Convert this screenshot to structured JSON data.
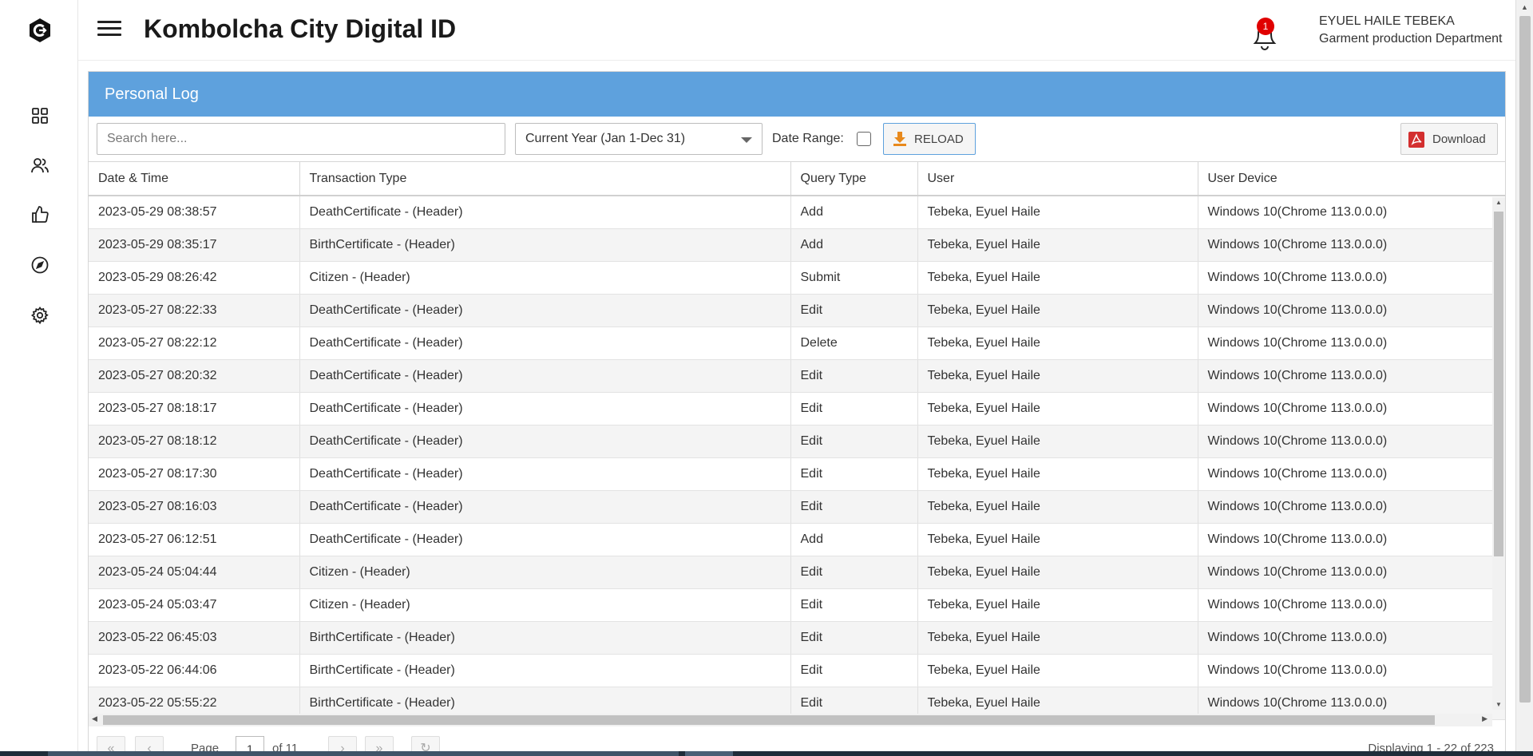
{
  "app": {
    "title": "Kombolcha City Digital ID"
  },
  "header": {
    "notification_count": "1",
    "user_name": "EYUEL HAILE TEBEKA",
    "user_department": "Garment production Department"
  },
  "sidebar": {
    "items": [
      {
        "icon": "dashboard-icon"
      },
      {
        "icon": "users-icon"
      },
      {
        "icon": "thumbs-up-icon"
      },
      {
        "icon": "compass-icon"
      },
      {
        "icon": "gear-icon"
      }
    ]
  },
  "panel": {
    "title": "Personal Log"
  },
  "toolbar": {
    "search_placeholder": "Search here...",
    "period_value": "Current Year (Jan 1-Dec 31)",
    "date_range_label": "Date Range:",
    "reload_label": "RELOAD",
    "download_label": "Download"
  },
  "table": {
    "columns": [
      "Date & Time",
      "Transaction Type",
      "Query Type",
      "User",
      "User Device"
    ],
    "rows": [
      [
        "2023-05-29 08:38:57",
        "DeathCertificate - (Header)",
        "Add",
        "Tebeka, Eyuel Haile",
        "Windows 10(Chrome 113.0.0.0)"
      ],
      [
        "2023-05-29 08:35:17",
        "BirthCertificate - (Header)",
        "Add",
        "Tebeka, Eyuel Haile",
        "Windows 10(Chrome 113.0.0.0)"
      ],
      [
        "2023-05-29 08:26:42",
        "Citizen - (Header)",
        "Submit",
        "Tebeka, Eyuel Haile",
        "Windows 10(Chrome 113.0.0.0)"
      ],
      [
        "2023-05-27 08:22:33",
        "DeathCertificate - (Header)",
        "Edit",
        "Tebeka, Eyuel Haile",
        "Windows 10(Chrome 113.0.0.0)"
      ],
      [
        "2023-05-27 08:22:12",
        "DeathCertificate - (Header)",
        "Delete",
        "Tebeka, Eyuel Haile",
        "Windows 10(Chrome 113.0.0.0)"
      ],
      [
        "2023-05-27 08:20:32",
        "DeathCertificate - (Header)",
        "Edit",
        "Tebeka, Eyuel Haile",
        "Windows 10(Chrome 113.0.0.0)"
      ],
      [
        "2023-05-27 08:18:17",
        "DeathCertificate - (Header)",
        "Edit",
        "Tebeka, Eyuel Haile",
        "Windows 10(Chrome 113.0.0.0)"
      ],
      [
        "2023-05-27 08:18:12",
        "DeathCertificate - (Header)",
        "Edit",
        "Tebeka, Eyuel Haile",
        "Windows 10(Chrome 113.0.0.0)"
      ],
      [
        "2023-05-27 08:17:30",
        "DeathCertificate - (Header)",
        "Edit",
        "Tebeka, Eyuel Haile",
        "Windows 10(Chrome 113.0.0.0)"
      ],
      [
        "2023-05-27 08:16:03",
        "DeathCertificate - (Header)",
        "Edit",
        "Tebeka, Eyuel Haile",
        "Windows 10(Chrome 113.0.0.0)"
      ],
      [
        "2023-05-27 06:12:51",
        "DeathCertificate - (Header)",
        "Add",
        "Tebeka, Eyuel Haile",
        "Windows 10(Chrome 113.0.0.0)"
      ],
      [
        "2023-05-24 05:04:44",
        "Citizen - (Header)",
        "Edit",
        "Tebeka, Eyuel Haile",
        "Windows 10(Chrome 113.0.0.0)"
      ],
      [
        "2023-05-24 05:03:47",
        "Citizen - (Header)",
        "Edit",
        "Tebeka, Eyuel Haile",
        "Windows 10(Chrome 113.0.0.0)"
      ],
      [
        "2023-05-22 06:45:03",
        "BirthCertificate - (Header)",
        "Edit",
        "Tebeka, Eyuel Haile",
        "Windows 10(Chrome 113.0.0.0)"
      ],
      [
        "2023-05-22 06:44:06",
        "BirthCertificate - (Header)",
        "Edit",
        "Tebeka, Eyuel Haile",
        "Windows 10(Chrome 113.0.0.0)"
      ],
      [
        "2023-05-22 05:55:22",
        "BirthCertificate - (Header)",
        "Edit",
        "Tebeka, Eyuel Haile",
        "Windows 10(Chrome 113.0.0.0)"
      ]
    ]
  },
  "pager": {
    "page_label": "Page",
    "page_value": "1",
    "of_label": "of 11",
    "display_info": "Displaying 1 - 22 of 223"
  },
  "colors": {
    "panel_header": "#5ea1dd",
    "badge": "#e00000",
    "pdf_icon": "#d32f2f",
    "reload_icon": "#e8891c"
  }
}
